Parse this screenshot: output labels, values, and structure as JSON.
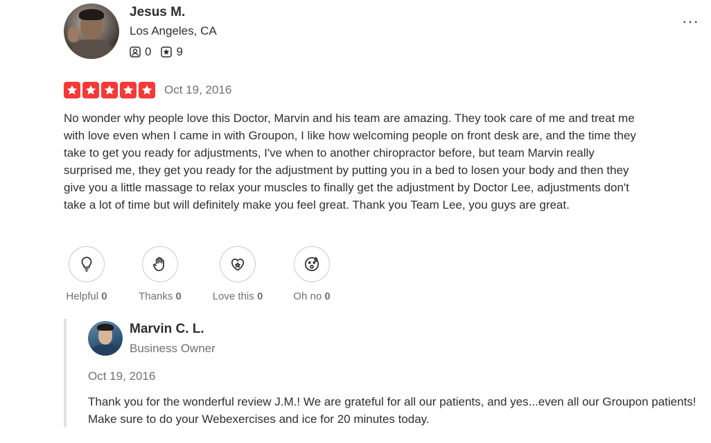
{
  "reviewer": {
    "name": "Jesus M.",
    "location": "Los Angeles, CA",
    "friends_count": "0",
    "reviews_count": "9"
  },
  "rating": {
    "stars": 5,
    "max": 5,
    "color": "#f43939"
  },
  "review": {
    "date": "Oct 19, 2016",
    "text": "No wonder why people love this Doctor, Marvin and his team are amazing. They took care of me and treat me with love even when I came in with Groupon, I like how welcoming people on front desk are, and the time they take to get you ready for adjustments, I've when to another chiropractor before, but team Marvin really surprised me, they get you ready for the adjustment by putting you in a bed to losen your body and then they give you a little massage to relax your muscles to finally get the adjustment by Doctor Lee, adjustments don't take a lot of time but will definitely make you feel great. Thank you Team Lee, you guys are great."
  },
  "reactions": [
    {
      "label": "Helpful",
      "count": "0",
      "icon": "lightbulb-icon"
    },
    {
      "label": "Thanks",
      "count": "0",
      "icon": "clap-hands-icon"
    },
    {
      "label": "Love this",
      "count": "0",
      "icon": "heart-sparkle-icon"
    },
    {
      "label": "Oh no",
      "count": "0",
      "icon": "surprised-face-icon"
    }
  ],
  "owner_reply": {
    "name": "Marvin C. L.",
    "role": "Business Owner",
    "date": "Oct 19, 2016",
    "text": "Thank you for the wonderful review J.M.! We are grateful for all our patients, and yes...even all our Groupon patients! Make sure to do your Webexercises and ice for 20 minutes today."
  },
  "menu": {
    "more_label": "···",
    "icon": "more-options-icon"
  }
}
